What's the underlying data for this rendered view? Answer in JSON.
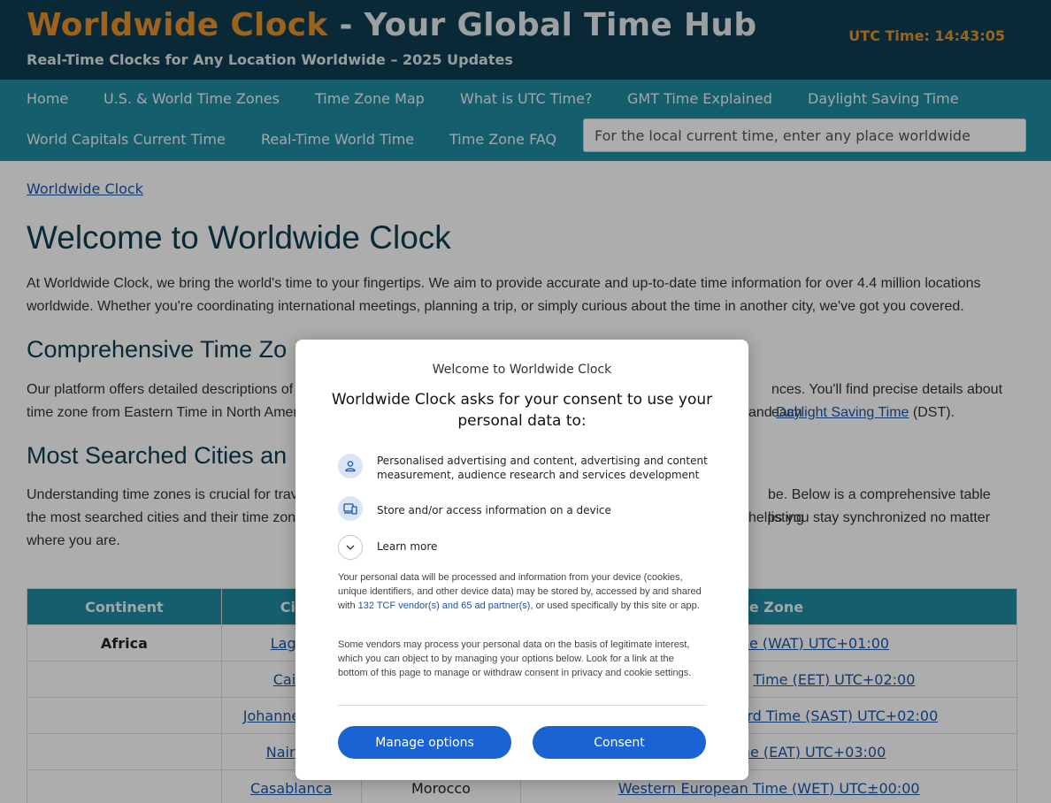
{
  "header": {
    "brand_accent": "Worldwide Clock",
    "brand_rest": " - Your Global Time Hub",
    "tagline": "Real-Time Clocks for Any Location Worldwide – 2025 Updates",
    "utc_time": "UTC Time: 14:43:05"
  },
  "nav": {
    "items": [
      {
        "label": "Home"
      },
      {
        "label": "U.S. & World Time Zones"
      },
      {
        "label": "Time Zone Map"
      },
      {
        "label": "What is UTC Time?"
      },
      {
        "label": "GMT Time Explained"
      },
      {
        "label": "Daylight Saving Time"
      },
      {
        "label": "World Capitals Current Time"
      },
      {
        "label": "Real-Time World Time"
      },
      {
        "label": "Time Zone FAQ"
      }
    ],
    "search_placeholder": "For the local current time, enter any place worldwide"
  },
  "breadcrumb": "Worldwide Clock",
  "main": {
    "title": "Welcome to Worldwide Clock",
    "intro": "At Worldwide Clock, we bring the world's time to your fingertips. We aim to provide accurate and up-to-date time information for over 4.4 million locations worldwide. Whether you're coordinating international meetings, planning a trip, or simply curious about the time in another city, we've got you covered.",
    "section1_title": "Comprehensive Time Zo",
    "section1_line1_start": "Our platform offers detailed descriptions of",
    "section1_line1_end": "nces. You'll find precise details about each",
    "section1_line2_start": "time zone from Eastern Time in North Amer",
    "section1_line2_and": "and ",
    "section1_line2_link": "Daylight Saving Time",
    "section1_line2_end": " (DST).",
    "section2_title": "Most Searched Cities an",
    "section2_line1_start": "Understanding time zones is crucial for trav",
    "section2_line1_end": "be. Below is a comprehensive table listing",
    "section2_line2_start": "the most searched cities and their time zon",
    "section2_line2_end": "helps you stay synchronized no matter",
    "section2_line3": "where you are."
  },
  "table": {
    "headers": [
      "Continent",
      "Cit",
      "",
      "me Zone"
    ],
    "rows": [
      {
        "continent": "Africa",
        "city": "Lag",
        "country": "",
        "zone": "me (WAT) UTC+01:00"
      },
      {
        "continent": "",
        "city": "Cai",
        "country": "",
        "zone": "Time (EET) UTC+02:00"
      },
      {
        "continent": "",
        "city": "Johanne",
        "country": "",
        "zone": "rd Time (SAST) UTC+02:00"
      },
      {
        "continent": "",
        "city": "Nair",
        "country": "",
        "zone": "me (EAT) UTC+03:00"
      },
      {
        "continent": "",
        "city": "Casablanca",
        "country": "Morocco",
        "zone": "Western European Time (WET) UTC±00:00"
      }
    ]
  },
  "consent": {
    "site_name": "Welcome to Worldwide Clock",
    "heading": "Worldwide Clock asks for your consent to use your personal data to:",
    "purposes": [
      {
        "icon": "person-icon",
        "text": "Personalised advertising and content, advertising and content measurement, audience research and services development"
      },
      {
        "icon": "device-icon",
        "text": "Store and/or access information on a device"
      }
    ],
    "learn_more": "Learn more",
    "body1_start": "Your personal data will be processed and information from your device (cookies, unique identifiers, and other device data) may be stored by, accessed by and shared with ",
    "body1_link": "132 TCF vendor(s) and 65 ad partner(s)",
    "body1_end": ", or used specifically by this site or app.",
    "body2": "Some vendors may process your personal data on the basis of legitimate interest, which you can object to by managing your options below. Look for a link at the bottom of this page to manage or withdraw consent in privacy and cookie settings.",
    "manage_label": "Manage options",
    "consent_label": "Consent"
  },
  "colors": {
    "header_bg": "#0f3d50",
    "nav_bg": "#1f8ba1",
    "brand_accent": "#e8922a",
    "button_blue": "#1a63d3",
    "link": "#1a55a8"
  }
}
